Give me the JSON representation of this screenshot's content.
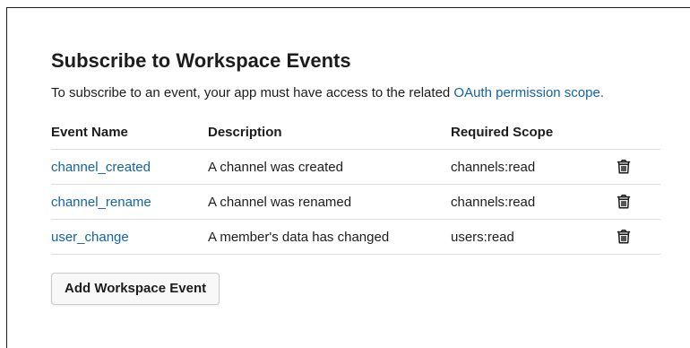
{
  "section": {
    "title": "Subscribe to Workspace Events",
    "description_prefix": "To subscribe to an event, your app must have access to the related ",
    "description_link": "OAuth permission scope."
  },
  "table": {
    "headers": {
      "event_name": "Event Name",
      "description": "Description",
      "required_scope": "Required Scope"
    },
    "rows": [
      {
        "event_name": "channel_created",
        "description": "A channel was created",
        "required_scope": "channels:read",
        "action_icon": "trash-icon"
      },
      {
        "event_name": "channel_rename",
        "description": "A channel was renamed",
        "required_scope": "channels:read",
        "action_icon": "trash-icon"
      },
      {
        "event_name": "user_change",
        "description": "A member's data has changed",
        "required_scope": "users:read",
        "action_icon": "trash-icon"
      }
    ]
  },
  "actions": {
    "add_button_label": "Add Workspace Event"
  },
  "colors": {
    "link": "#1264a3",
    "text": "#1d1c1d",
    "divider": "#dddddd"
  }
}
